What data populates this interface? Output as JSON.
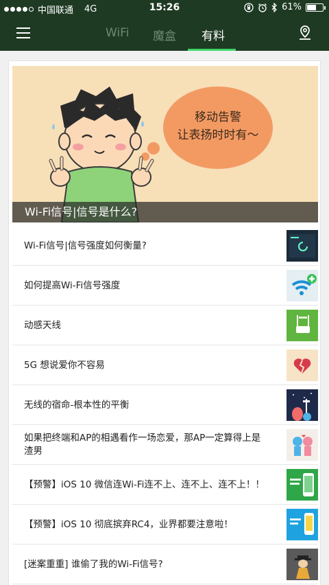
{
  "status": {
    "carrier": "中国联通",
    "network": "4G",
    "time": "15:26",
    "battery_text": "61%",
    "battery_level": 0.61
  },
  "nav": {
    "tabs": [
      {
        "label": "WiFi",
        "active": false
      },
      {
        "label": "魔盒",
        "active": false
      },
      {
        "label": "有料",
        "active": true
      }
    ],
    "accent": "#3cd66a",
    "menu_icon": "menu-icon",
    "location_icon": "location-pin-icon"
  },
  "banner": {
    "bubble_line1": "移动告警",
    "bubble_line2": "让表扬时时有～",
    "caption": "Wi-Fi信号|信号是什么?"
  },
  "articles": [
    {
      "title": "Wi-Fi信号|信号强度如何衡量?",
      "thumb": "dark-screen-thumb"
    },
    {
      "title": "如何提高Wi-Fi信号强度",
      "thumb": "wifi-plus-thumb"
    },
    {
      "title": "动感天线",
      "thumb": "green-router-thumb"
    },
    {
      "title": "5G 想说爱你不容易",
      "thumb": "broken-heart-thumb"
    },
    {
      "title": "无线的宿命-根本性的平衡",
      "thumb": "night-illustration-thumb"
    },
    {
      "title": "如果把终端和AP的相遇看作一场恋爱，那AP一定算得上是渣男",
      "thumb": "couple-illustration-thumb"
    },
    {
      "title": "【预警】iOS 10 微信连Wi-Fi连不上、连不上、连不上！！",
      "thumb": "green-phone-thumb"
    },
    {
      "title": "【预警】iOS 10 彻底摈弃RC4，业界都要注意啦！",
      "thumb": "blue-phone-thumb"
    },
    {
      "title": "[迷案重重] 谁偷了我的Wi-Fi信号?",
      "thumb": "detective-thumb"
    }
  ]
}
